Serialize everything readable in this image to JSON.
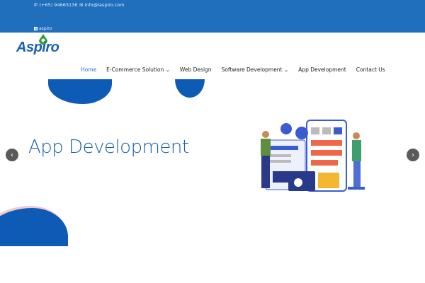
{
  "topbar": {
    "phone": "(+65) 94663136",
    "email": "info@iaspiro.com",
    "broken_logo_alt": "aspiro"
  },
  "logo": {
    "text": "Aspiro"
  },
  "nav": {
    "items": [
      {
        "label": "Home",
        "active": true
      },
      {
        "label": "E-Commerce Solution ⌄"
      },
      {
        "label": "Web Design"
      },
      {
        "label": "Software Development ⌄"
      },
      {
        "label": "App Development"
      },
      {
        "label": "Contact Us"
      }
    ]
  },
  "hero": {
    "title": "App Development",
    "prev": "‹",
    "next": "›"
  },
  "colors": {
    "brand": "#1f6fbd",
    "accent": "#0d5bb5",
    "logo_green": "#2e9e3e"
  }
}
